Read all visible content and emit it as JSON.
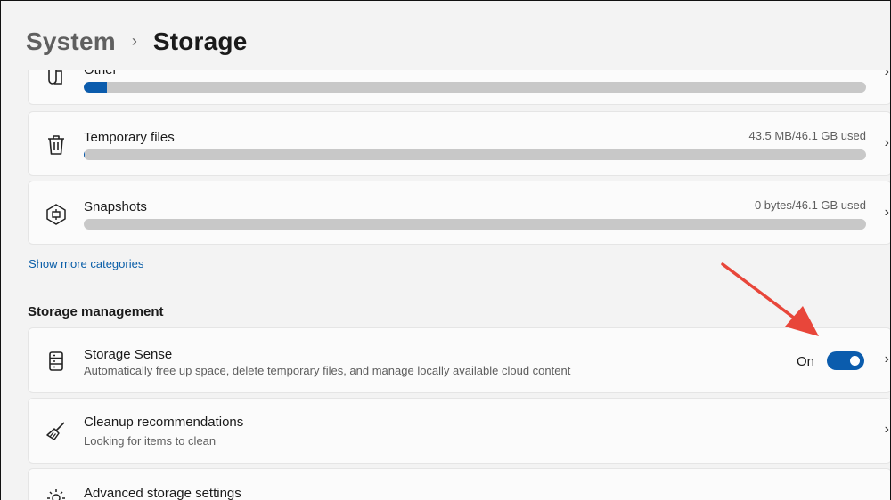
{
  "header": {
    "parent": "System",
    "separator": "›",
    "current": "Storage"
  },
  "categories": [
    {
      "name": "Other",
      "used_text": "",
      "fraction": 0.03,
      "icon": "document-icon"
    },
    {
      "name": "Temporary files",
      "used_text": "43.5 MB/46.1 GB used",
      "fraction": 0.001,
      "icon": "trash-icon"
    },
    {
      "name": "Snapshots",
      "used_text": "0 bytes/46.1 GB used",
      "fraction": 0.0,
      "icon": "snapshot-icon"
    }
  ],
  "show_more": "Show more categories",
  "storage_management": {
    "heading": "Storage management",
    "storage_sense": {
      "title": "Storage Sense",
      "description": "Automatically free up space, delete temporary files, and manage locally available cloud content",
      "toggle_label": "On",
      "toggle_on": true,
      "icon": "drive-icon"
    },
    "cleanup": {
      "title": "Cleanup recommendations",
      "description": "Looking for items to clean",
      "icon": "broom-icon"
    },
    "advanced": {
      "title": "Advanced storage settings",
      "icon": "gear-icon"
    }
  },
  "chevron": "›",
  "colors": {
    "accent": "#0b5cad",
    "annotation_arrow": "#e8463a",
    "bar_track": "#c8c8c8"
  }
}
